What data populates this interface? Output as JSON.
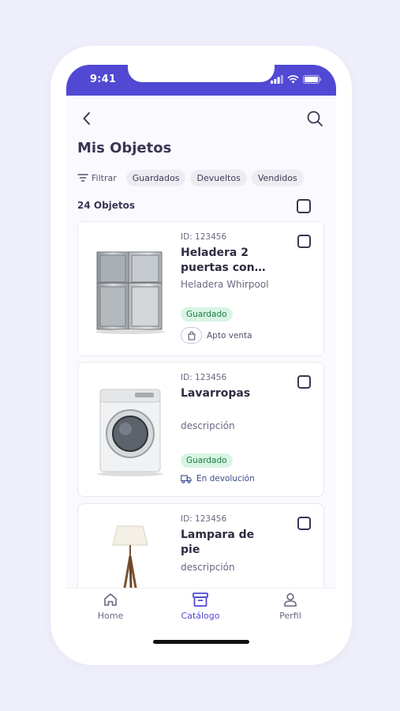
{
  "status": {
    "time": "9:41"
  },
  "header": {
    "title": "Mis Objetos"
  },
  "filters": {
    "filter_label": "Filtrar",
    "chips": [
      "Guardados",
      "Devueltos",
      "Vendidos"
    ]
  },
  "list": {
    "count_label": "24 Objetos",
    "items": [
      {
        "id": "ID: 123456",
        "name": "Heladera 2 puertas con…",
        "description": "Heladera Whirpool",
        "badge": "Guardado",
        "meta": "Apto venta",
        "meta_icon": "shopping-bag-icon",
        "image": "refrigerator"
      },
      {
        "id": "ID: 123456",
        "name": "Lavarropas",
        "description": "descripción",
        "badge": "Guardado",
        "meta": "En devolución",
        "meta_icon": "truck-icon",
        "image": "washing-machine"
      },
      {
        "id": "ID: 123456",
        "name": "Lampara de pie",
        "description": "descripción",
        "image": "floor-lamp"
      }
    ]
  },
  "tabbar": {
    "tabs": [
      {
        "label": "Home",
        "icon": "home-icon"
      },
      {
        "label": "Catálogo",
        "icon": "archive-box-icon",
        "active": true
      },
      {
        "label": "Perfil",
        "icon": "user-icon"
      }
    ]
  },
  "colors": {
    "accent": "#5148d3",
    "badge_bg": "#d8f5e4",
    "badge_text": "#1c7a45",
    "background": "#efeffb"
  }
}
